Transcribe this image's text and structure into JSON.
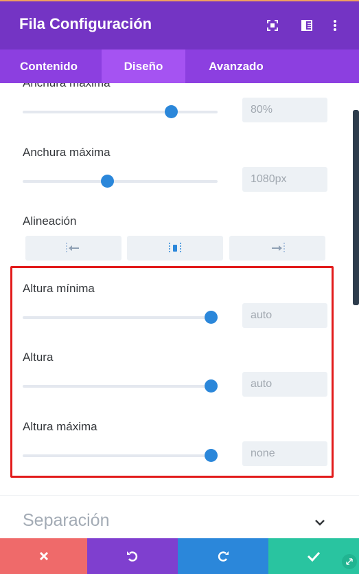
{
  "header": {
    "title": "Fila Configuración",
    "icons": [
      "focus-icon",
      "split-view-icon",
      "more-icon"
    ],
    "bg_color": "#7434c4"
  },
  "tabs": [
    {
      "label": "Contenido",
      "active": false
    },
    {
      "label": "Diseño",
      "active": true
    },
    {
      "label": "Avanzado",
      "active": false
    }
  ],
  "settings": {
    "max_width_pct": {
      "label": "Anchura máxima",
      "value": "80%",
      "level": 0.78
    },
    "max_width_px": {
      "label": "Anchura máxima",
      "value": "1080px",
      "level": 0.43
    },
    "alignment": {
      "label": "Alineación",
      "options": [
        "align-left-icon",
        "align-center-icon",
        "align-right-icon"
      ],
      "selected": "center"
    },
    "min_height": {
      "label": "Altura mínima",
      "value": "auto",
      "level": 1.0
    },
    "height": {
      "label": "Altura",
      "value": "auto",
      "level": 1.0
    },
    "max_height": {
      "label": "Altura máxima",
      "value": "none",
      "level": 1.0
    }
  },
  "section": {
    "label": "Separación",
    "icon": "chevron-down-icon"
  },
  "footer": {
    "buttons": [
      {
        "name": "cancel",
        "icon": "close-icon",
        "color": "#ef6a6a"
      },
      {
        "name": "undo",
        "icon": "undo-icon",
        "color": "#7f3fcf"
      },
      {
        "name": "redo",
        "icon": "redo-icon",
        "color": "#2b87da"
      },
      {
        "name": "save",
        "icon": "check-icon",
        "color": "#29c4a0"
      }
    ]
  },
  "colors": {
    "accent": "#2b87da",
    "highlight_border": "#e21b1b",
    "tab_active": "#a553f2"
  }
}
